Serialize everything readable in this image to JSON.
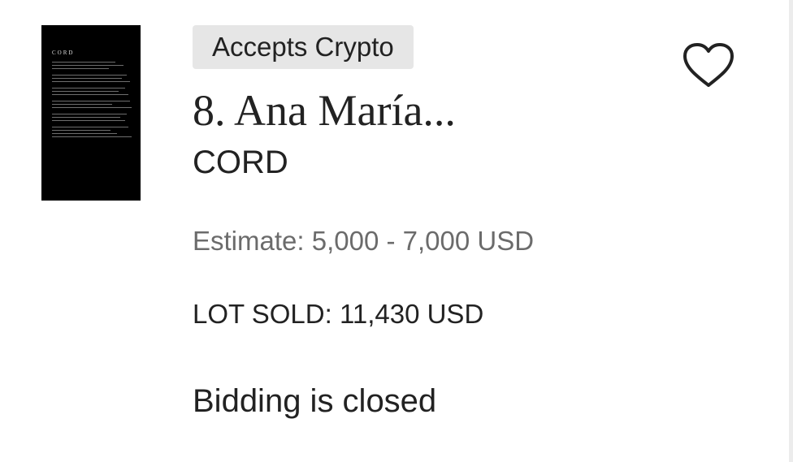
{
  "lot": {
    "badge": "Accepts Crypto",
    "title": "8. Ana María...",
    "subtitle": "CORD",
    "estimate": "Estimate: 5,000 - 7,000 USD",
    "sold": "LOT SOLD: 11,430 USD",
    "status": "Bidding is closed",
    "thumbnail": {
      "heading": "CORD",
      "background": "#000000"
    },
    "favorite_icon": "heart-outline-icon"
  },
  "colors": {
    "text_primary": "#222222",
    "text_secondary": "#6b6b6b",
    "badge_background": "#e6e6e6"
  }
}
